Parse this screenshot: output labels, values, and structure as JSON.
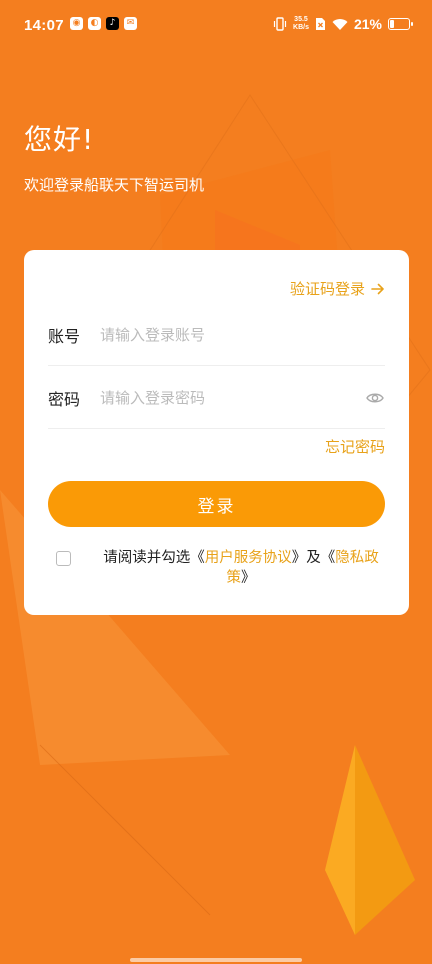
{
  "status_bar": {
    "time": "14:07",
    "net_speed_value": "35.5",
    "net_speed_unit": "KB/s",
    "battery_percent": "21%",
    "battery_level": 0.21,
    "notification_icons": [
      "weibo-icon",
      "browser-icon",
      "tiktok-icon",
      "mail-icon"
    ]
  },
  "header": {
    "greeting": "您好!",
    "welcome": "欢迎登录船联天下智运司机"
  },
  "login_card": {
    "sms_login_label": "验证码登录",
    "account": {
      "label": "账号",
      "placeholder": "请输入登录账号",
      "value": ""
    },
    "password": {
      "label": "密码",
      "placeholder": "请输入登录密码",
      "value": ""
    },
    "forgot_password": "忘记密码",
    "login_button": "登录",
    "agreement": {
      "checked": false,
      "prefix": "请阅读并勾选",
      "open_quote_1": "《",
      "user_agreement": "用户服务协议",
      "close_quote_1": "》",
      "and": "及",
      "open_quote_2": "《",
      "privacy_policy": "隐私政策",
      "close_quote_2": "》"
    }
  },
  "colors": {
    "background": "#F47E1F",
    "accent_text": "#E8A21A",
    "button": "#FA9A06"
  }
}
